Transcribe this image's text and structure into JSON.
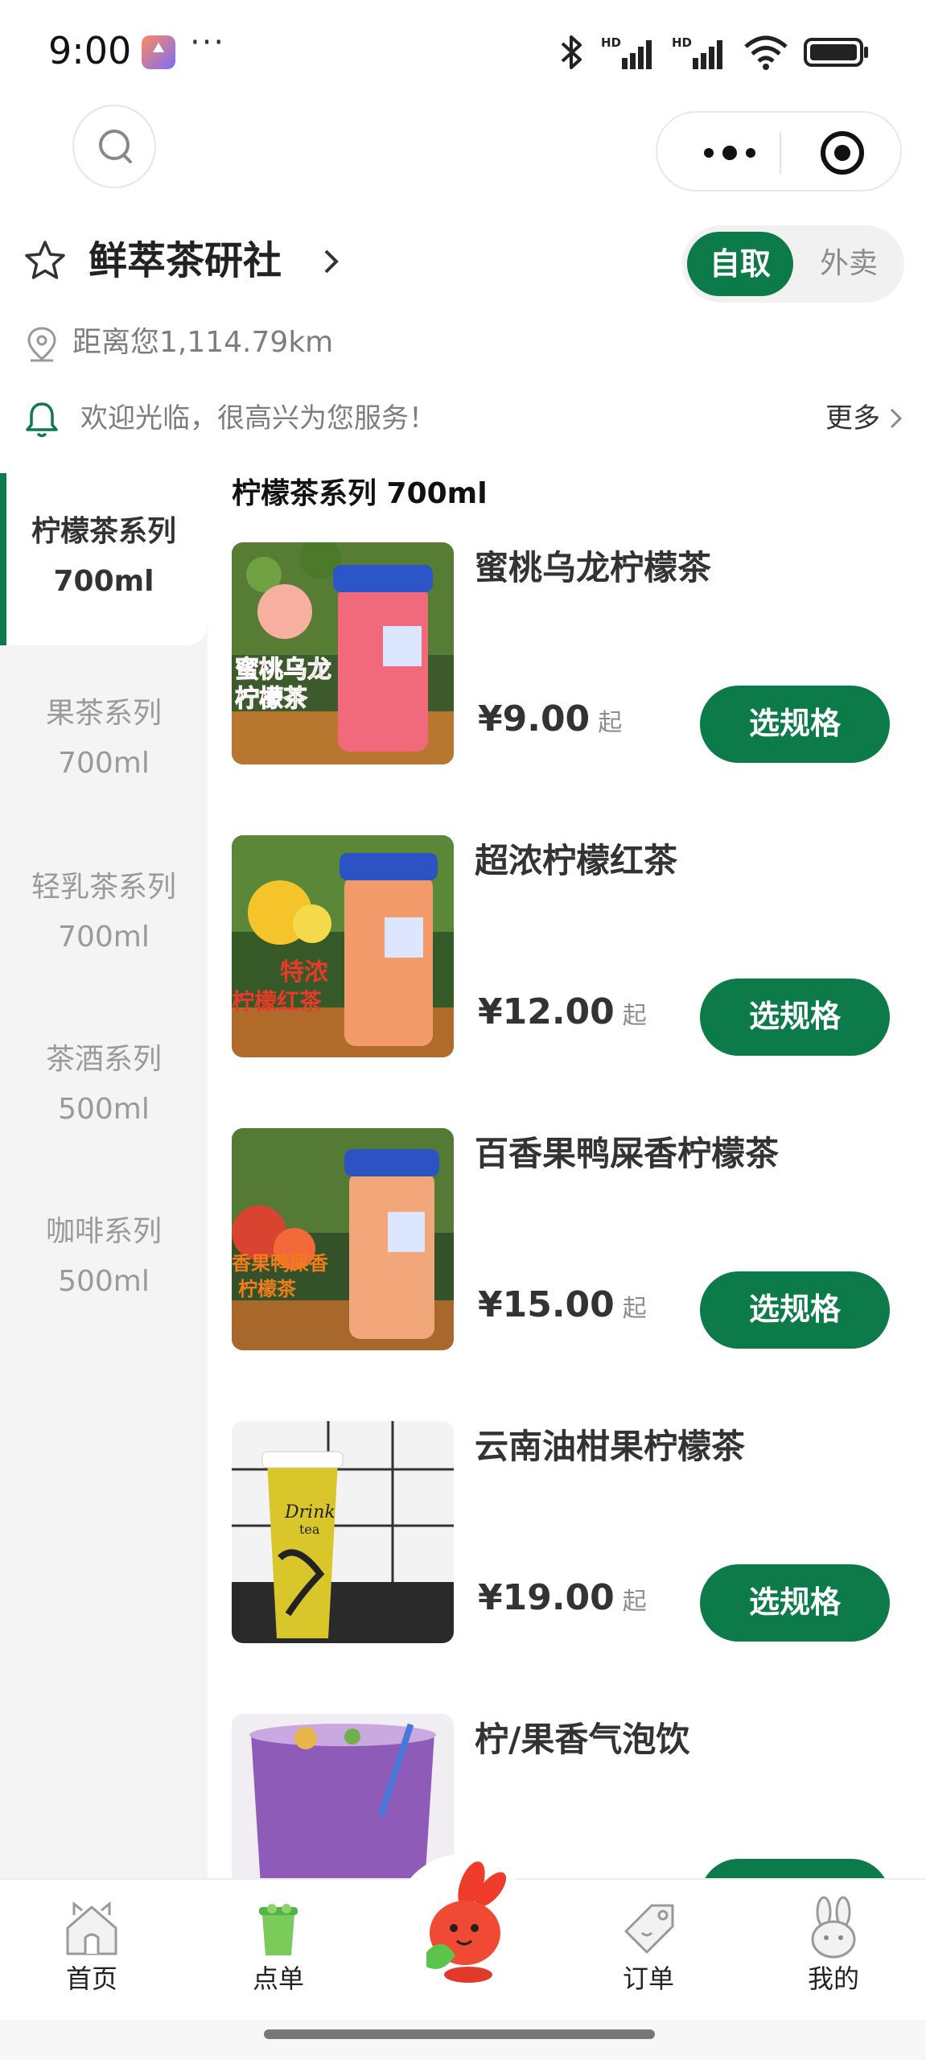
{
  "status_bar": {
    "time": "9:00",
    "more": "···",
    "icons": [
      "bluetooth-icon",
      "hd-signal-icon",
      "hd-signal-icon",
      "wifi-icon",
      "battery-icon"
    ]
  },
  "nav": {
    "search_icon": "search-icon",
    "capsule_icons": [
      "more-dots-icon",
      "close-target-icon"
    ]
  },
  "store": {
    "name": "鲜萃茶研社",
    "distance": "距离您1,114.79km",
    "notice": "欢迎光临，很高兴为您服务！",
    "notice_more": "更多",
    "modes": {
      "pickup": "自取",
      "delivery": "外卖",
      "selected": "pickup"
    }
  },
  "colors": {
    "brand_green": "#0d7a4a",
    "sidebar_bg": "#f4f4f4"
  },
  "categories": [
    {
      "name": "柠檬茶系列",
      "size": "700ml",
      "active": true
    },
    {
      "name": "果茶系列",
      "size": "700ml",
      "active": false
    },
    {
      "name": "轻乳茶系列",
      "size": "700ml",
      "active": false
    },
    {
      "name": "茶酒系列",
      "size": "500ml",
      "active": false
    },
    {
      "name": "咖啡系列",
      "size": "500ml",
      "active": false
    }
  ],
  "section_title": "柠檬茶系列 700ml",
  "products": [
    {
      "name": "蜜桃乌龙柠檬茶",
      "price": "¥9.00",
      "from": "起",
      "button": "选规格",
      "image_text": [
        "蜜桃乌龙",
        "柠檬茶"
      ]
    },
    {
      "name": "超浓柠檬红茶",
      "price": "¥12.00",
      "from": "起",
      "button": "选规格",
      "image_text": [
        "特浓",
        "柠檬红茶"
      ]
    },
    {
      "name": "百香果鸭屎香柠檬茶",
      "price": "¥15.00",
      "from": "起",
      "button": "选规格",
      "image_text": [
        "香果鸭屎香",
        "柠檬茶"
      ]
    },
    {
      "name": "云南油柑果柠檬茶",
      "price": "¥19.00",
      "from": "起",
      "button": "选规格",
      "image_text": [
        "Drink",
        "tea"
      ]
    },
    {
      "name": "柠/果香气泡饮",
      "price": "",
      "from": "",
      "button": "",
      "image_text": []
    }
  ],
  "tabbar": {
    "tabs": [
      {
        "label": "首页",
        "icon": "home-icon"
      },
      {
        "label": "点单",
        "icon": "cup-icon"
      },
      {
        "label": "订单",
        "icon": "tag-icon"
      },
      {
        "label": "我的",
        "icon": "bunny-icon"
      }
    ],
    "center_icon": "mascot-icon",
    "active": "点单"
  }
}
